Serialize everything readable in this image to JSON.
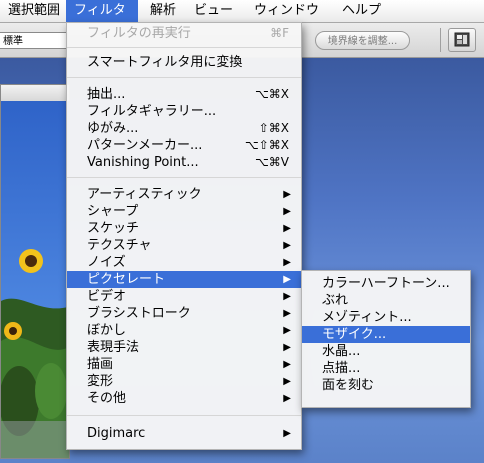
{
  "menubar": {
    "items": [
      {
        "label": "選択範囲",
        "active": false
      },
      {
        "label": "フィルタ",
        "active": true
      },
      {
        "label": "解析",
        "active": false
      },
      {
        "label": "ビュー",
        "active": false
      },
      {
        "label": "ウィンドウ",
        "active": false
      },
      {
        "label": "ヘルプ",
        "active": false
      }
    ]
  },
  "options_bar": {
    "style_value": "標準",
    "refine_edge_label": "境界線を調整...",
    "palette_icon": "palette-well-icon"
  },
  "filter_menu": {
    "last_filter": {
      "label": "フィルタの再実行",
      "shortcut": "⌘F"
    },
    "smart_filter": {
      "label": "スマートフィルタ用に変換"
    },
    "group1": [
      {
        "label": "抽出...",
        "shortcut": "⌥⌘X"
      },
      {
        "label": "フィルタギャラリー...",
        "shortcut": ""
      },
      {
        "label": "ゆがみ...",
        "shortcut": "⇧⌘X"
      },
      {
        "label": "パターンメーカー...",
        "shortcut": "⌥⇧⌘X"
      },
      {
        "label": "Vanishing Point...",
        "shortcut": "⌥⌘V"
      }
    ],
    "submenus": [
      {
        "label": "アーティスティック"
      },
      {
        "label": "シャープ"
      },
      {
        "label": "スケッチ"
      },
      {
        "label": "テクスチャ"
      },
      {
        "label": "ノイズ"
      },
      {
        "label": "ピクセレート"
      },
      {
        "label": "ビデオ"
      },
      {
        "label": "ブラシストローク"
      },
      {
        "label": "ぼかし"
      },
      {
        "label": "表現手法"
      },
      {
        "label": "描画"
      },
      {
        "label": "変形"
      },
      {
        "label": "その他"
      }
    ],
    "highlighted": "ピクセレート",
    "plugins": [
      {
        "label": "Digimarc"
      }
    ],
    "arrow_glyph": "▶"
  },
  "pixelate_submenu": {
    "items": [
      {
        "label": "カラーハーフトーン..."
      },
      {
        "label": "ぶれ"
      },
      {
        "label": "メゾティント..."
      },
      {
        "label": "モザイク..."
      },
      {
        "label": "水晶..."
      },
      {
        "label": "点描..."
      },
      {
        "label": "面を刻む"
      }
    ],
    "highlighted": "モザイク..."
  },
  "colors": {
    "highlight": "#3a6fd8",
    "disabled_text": "#a8a8a8"
  }
}
